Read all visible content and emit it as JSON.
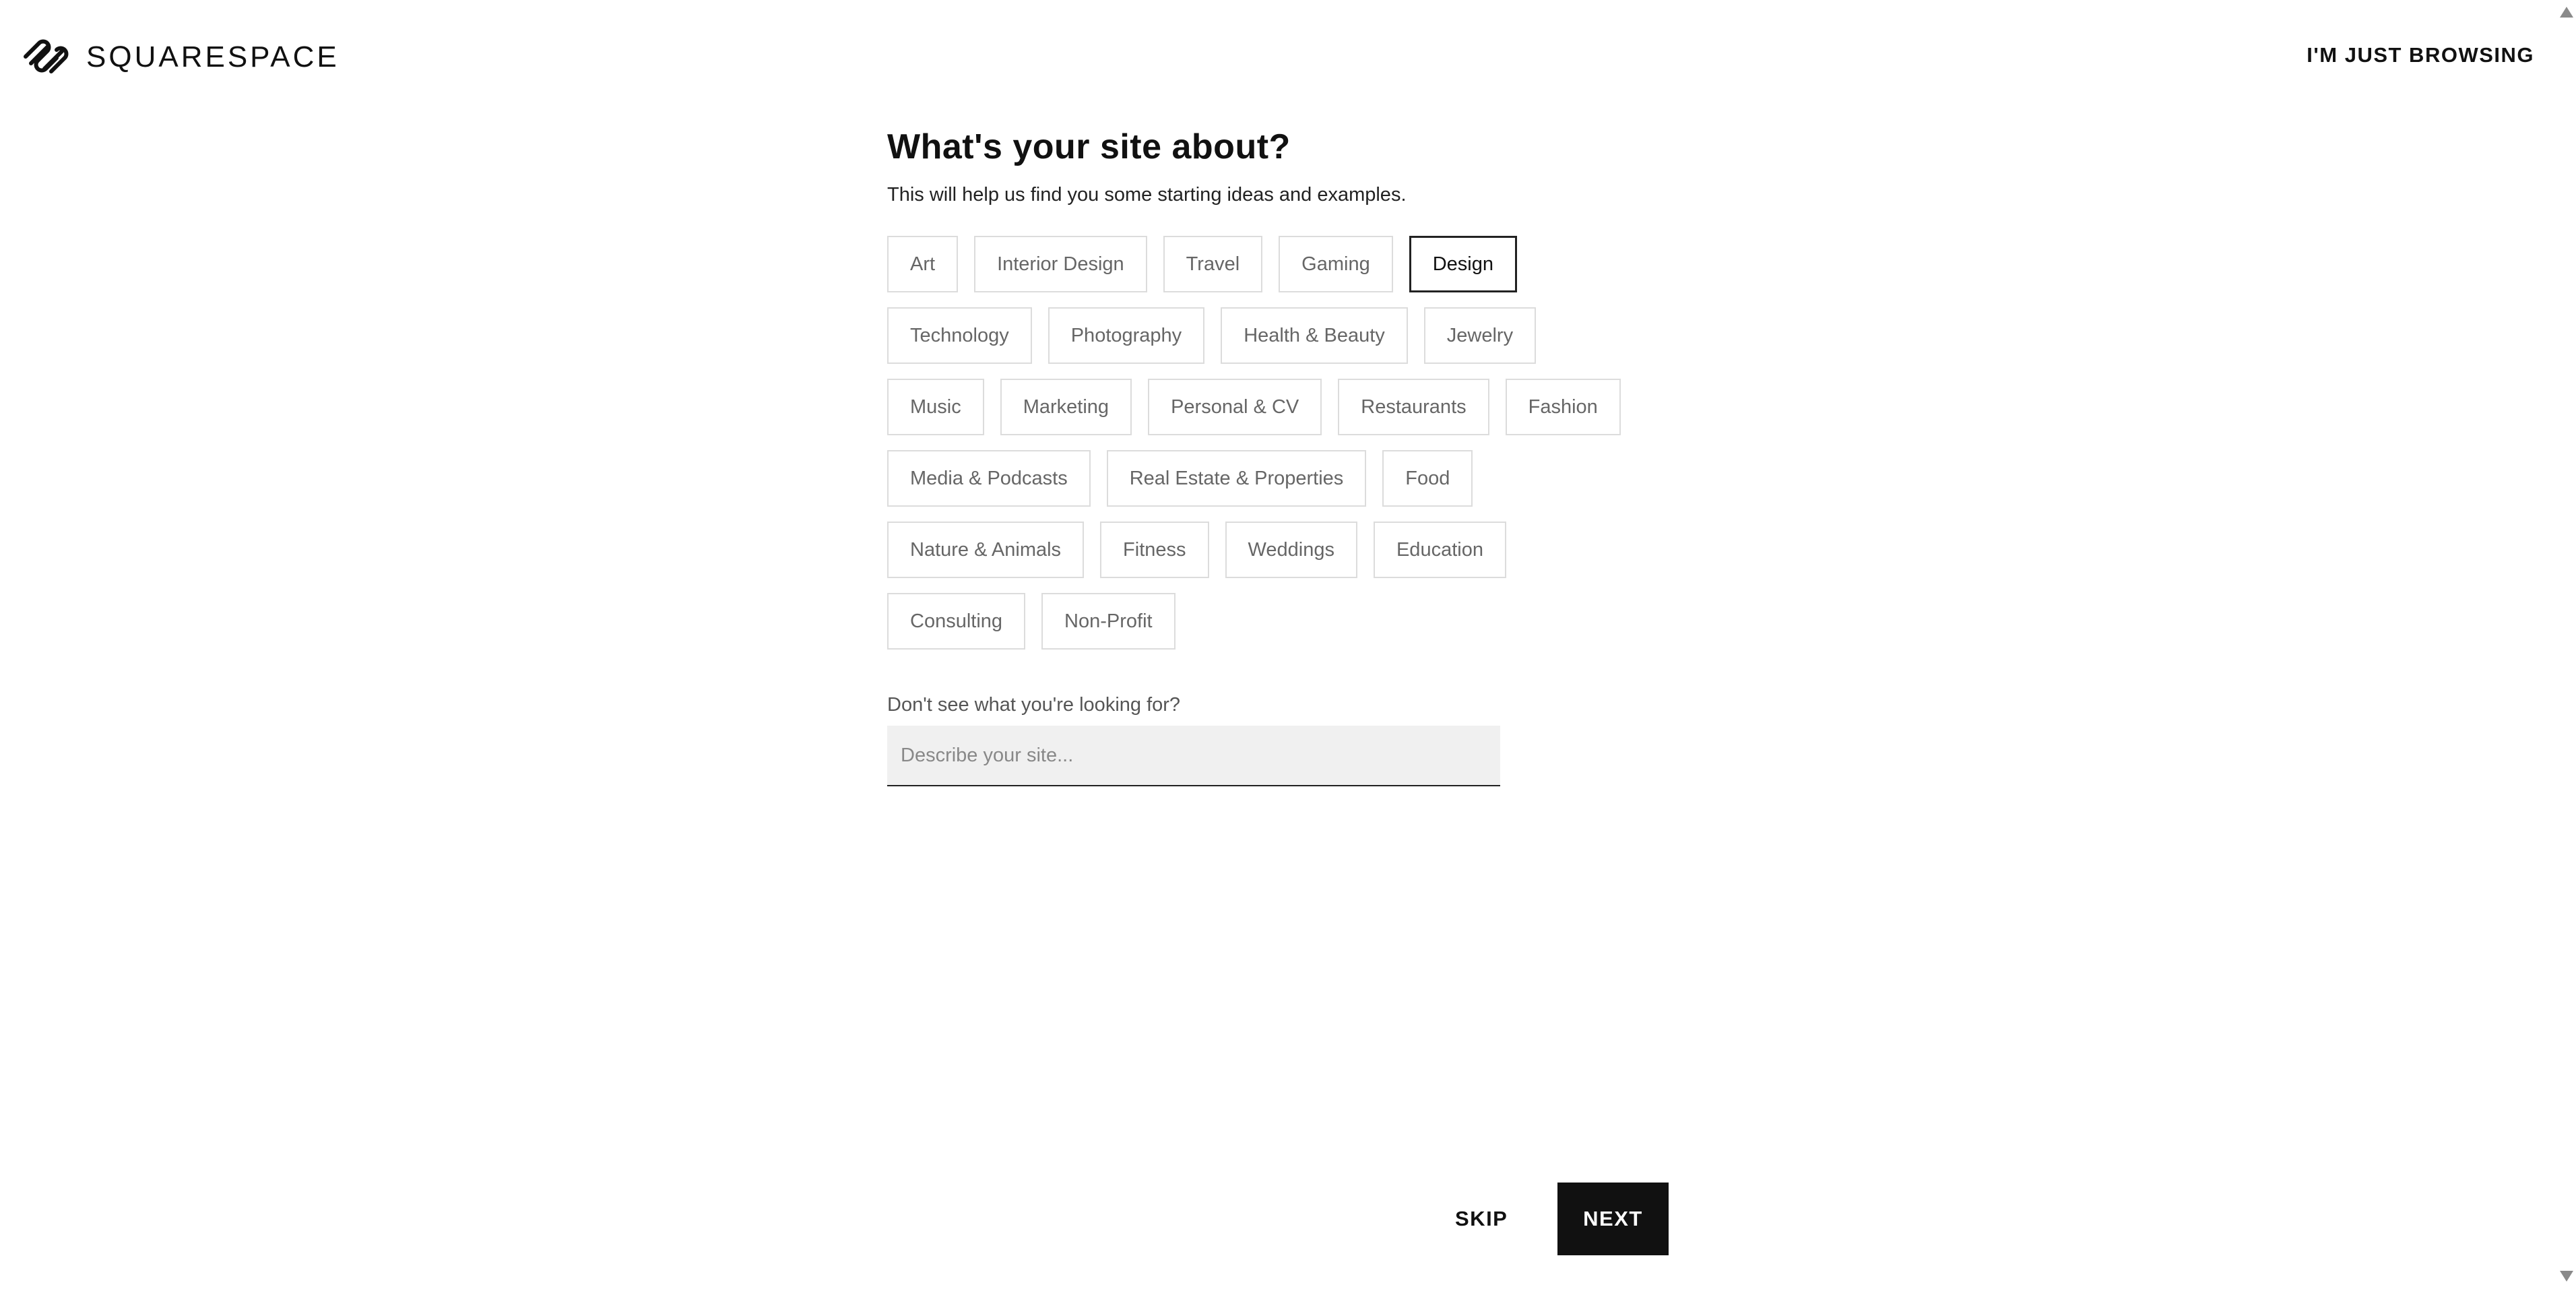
{
  "header": {
    "logo_text": "SQUARESPACE",
    "browse_label": "I'M JUST BROWSING"
  },
  "main": {
    "title": "What's your site about?",
    "subtitle": "This will help us find you some starting ideas and examples.",
    "selected_topic": "Design",
    "topic_rows": [
      [
        "Art",
        "Interior Design",
        "Travel",
        "Gaming",
        "Design"
      ],
      [
        "Technology",
        "Photography",
        "Health & Beauty",
        "Jewelry"
      ],
      [
        "Music",
        "Marketing",
        "Personal & CV",
        "Restaurants",
        "Fashion"
      ],
      [
        "Media & Podcasts",
        "Real Estate & Properties",
        "Food"
      ],
      [
        "Nature & Animals",
        "Fitness",
        "Weddings",
        "Education"
      ],
      [
        "Consulting",
        "Non-Profit"
      ]
    ],
    "custom": {
      "label": "Don't see what you're looking for?",
      "placeholder": "Describe your site...",
      "value": ""
    }
  },
  "footer": {
    "skip_label": "SKIP",
    "next_label": "NEXT"
  },
  "colors": {
    "primary": "#111111",
    "chip_border": "#dcdcdc",
    "input_bg": "#f0f0f0"
  },
  "icons": {
    "logo": "squarespace-logo-icon",
    "scroll_up": "scroll-up-arrow-icon",
    "scroll_down": "scroll-down-arrow-icon"
  }
}
